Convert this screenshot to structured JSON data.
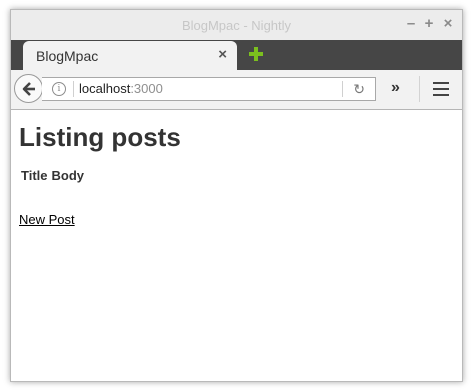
{
  "window": {
    "title": "BlogMpac - Nightly"
  },
  "tab": {
    "label": "BlogMpac"
  },
  "navbar": {
    "url_host": "localhost",
    "url_port": ":3000"
  },
  "page": {
    "heading": "Listing posts",
    "table": {
      "columns": [
        "Title",
        "Body"
      ]
    },
    "new_post_link": "New Post"
  },
  "colors": {
    "tabstrip": "#464646",
    "new_tab_icon": "#7bbf1e",
    "titlebar": "#ececec"
  },
  "icons": {
    "back": "arrow-left-icon",
    "info": "info-icon",
    "reload": "reload-icon",
    "overflow": "chevron-double-right-icon",
    "menu": "hamburger-icon",
    "new_tab": "plus-icon",
    "close_tab": "close-icon"
  }
}
